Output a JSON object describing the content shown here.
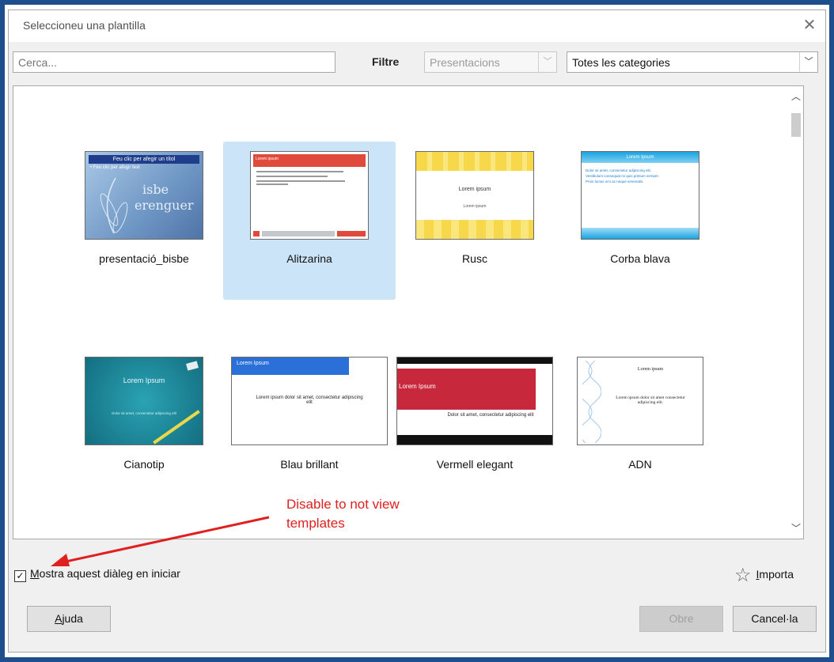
{
  "dialog": {
    "title": "Seleccioneu una plantilla"
  },
  "search": {
    "placeholder": "Cerca..."
  },
  "filter": {
    "label": "Filtre",
    "type_value": "Presentacions",
    "category_value": "Totes les categories"
  },
  "templates": [
    {
      "name": "presentació_bisbe",
      "thumb_title": "Feu clic per afegir un títol",
      "thumb_bullet": "• Feu clic per afegir text",
      "thumb_logo_1": "isbe",
      "thumb_logo_2": "erenguer"
    },
    {
      "name": "Alitzarina",
      "selected": true,
      "thumb_title": "Lorem ipsum"
    },
    {
      "name": "Rusc",
      "thumb_title": "Lorem ipsum",
      "thumb_sub": "Lorem ipsum"
    },
    {
      "name": "Corba blava",
      "thumb_title": "Lorem Ipsum",
      "thumb_bullets": [
        "Dolor sit amet, consectetur adipiscing elit.",
        "Vestibulum consequat mi quis pretium semper.",
        "Proin luctus orci ac neque venenatis."
      ]
    },
    {
      "name": "Cianotip",
      "thumb_title": "Lorem Ipsum",
      "thumb_sub": "Dolor sit amet, consectetur adipiscing elit"
    },
    {
      "name": "Blau brillant",
      "thumb_title": "Lorem Ipsum",
      "thumb_body": "Lorem ipsum dolor sit amet, consectetur adipiscing elit"
    },
    {
      "name": "Vermell elegant",
      "thumb_title": "Lorem Ipsum",
      "thumb_body": "Dolor sit amet, consectetur adipiscing elit"
    },
    {
      "name": "ADN",
      "thumb_title": "Lorem ipsum",
      "thumb_body": "Lorem ipsum dolor sit amet consectetur adipiscing elit."
    }
  ],
  "startup_checkbox": {
    "label_mnemonic": "M",
    "label_rest": "ostra aquest diàleg en iniciar",
    "checked": true
  },
  "import": {
    "label_mnemonic": "I",
    "label_rest": "mporta"
  },
  "buttons": {
    "help_mnemonic": "A",
    "help_rest": "juda",
    "open": "Obre",
    "cancel": "Cancel·la"
  },
  "annotation": {
    "line1": "Disable to not view",
    "line2": "templates"
  },
  "colors": {
    "accent": "#1f4e8c",
    "selection": "#cce4f7",
    "annotation": "#e02020"
  }
}
